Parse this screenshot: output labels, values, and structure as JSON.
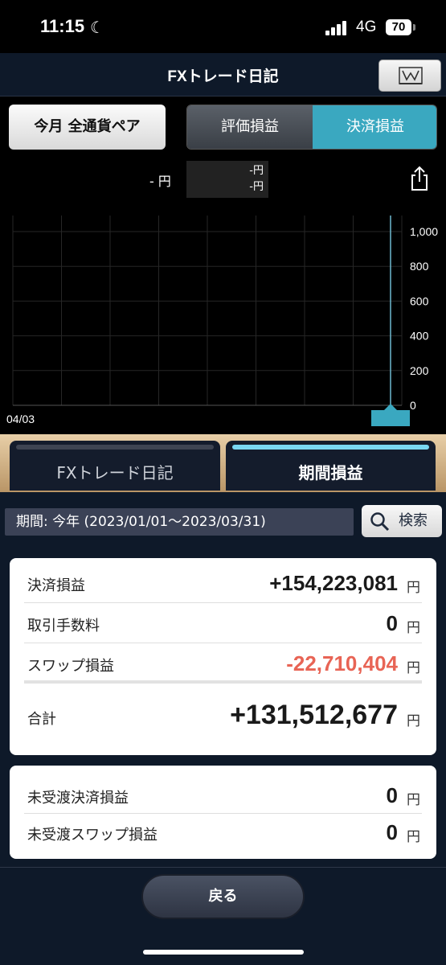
{
  "status": {
    "time": "11:15",
    "network": "4G",
    "battery": "70"
  },
  "header": {
    "title": "FXトレード日記"
  },
  "filter": {
    "period_button": "今月 全通貨ペア",
    "segments": [
      "評価損益",
      "決済損益"
    ]
  },
  "chart_legend": {
    "main": "- 円",
    "line1": "-円",
    "line2": "-円"
  },
  "chart_data": {
    "type": "bar",
    "categories": [
      "04/03"
    ],
    "values": [
      0
    ],
    "xlabel": "",
    "ylabel": "",
    "ylim": [
      0,
      1000
    ],
    "yticks": [
      "1,000",
      "800",
      "600",
      "400",
      "200",
      "0"
    ],
    "x_label": "04/03",
    "grid": true
  },
  "tabs": [
    {
      "label": "FXトレード日記"
    },
    {
      "label": "期間損益"
    }
  ],
  "period": {
    "text": "期間: 今年 (2023/01/01～2023/03/31)",
    "search_label": "検索"
  },
  "summary": {
    "rows": [
      {
        "label": "決済損益",
        "value": "+154,223,081",
        "unit": "円"
      },
      {
        "label": "取引手数料",
        "value": "0",
        "unit": "円"
      },
      {
        "label": "スワップ損益",
        "value": "-22,710,404",
        "unit": "円"
      }
    ],
    "total": {
      "label": "合計",
      "value": "+131,512,677",
      "unit": "円"
    }
  },
  "unsettled": {
    "rows": [
      {
        "label": "未受渡決済損益",
        "value": "0",
        "unit": "円"
      },
      {
        "label": "未受渡スワップ損益",
        "value": "0",
        "unit": "円"
      }
    ]
  },
  "footer": {
    "back_label": "戻る"
  }
}
